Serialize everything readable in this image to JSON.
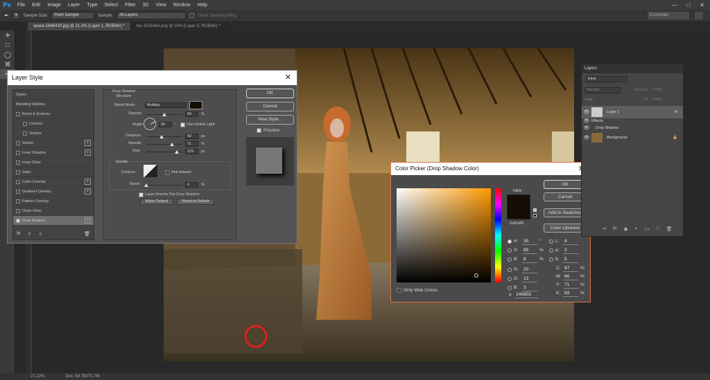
{
  "menubar": {
    "logo": "Ps",
    "items": [
      "File",
      "Edit",
      "Image",
      "Layer",
      "Type",
      "Select",
      "Filter",
      "3D",
      "View",
      "Window",
      "Help"
    ]
  },
  "options": {
    "sample_size_label": "Sample Size:",
    "sample_size_value": "Point Sample",
    "sample_label": "Sample:",
    "sample_value": "All Layers",
    "sampling_ring": "Show Sampling Ring",
    "workspace": "Essentials"
  },
  "tabs": [
    "space-1646420.jpg @ 21.2% (Layer 1, RGB/8#) *",
    "tax-1625464.png @ 25% (Layer 0, RGB/8#) *"
  ],
  "status": {
    "zoom": "21.22%",
    "doc": "Doc: 59.7M/73.7M"
  },
  "layer_style": {
    "title": "Layer Style",
    "styles_header": "Styles",
    "items": [
      {
        "label": "Blending Options",
        "checkbox": false,
        "plus": false,
        "indent": false,
        "checked": false
      },
      {
        "label": "Bevel & Emboss",
        "checkbox": true,
        "plus": false,
        "indent": false,
        "checked": false
      },
      {
        "label": "Contour",
        "checkbox": true,
        "plus": false,
        "indent": true,
        "checked": false
      },
      {
        "label": "Texture",
        "checkbox": true,
        "plus": false,
        "indent": true,
        "checked": false
      },
      {
        "label": "Stroke",
        "checkbox": true,
        "plus": true,
        "indent": false,
        "checked": false
      },
      {
        "label": "Inner Shadow",
        "checkbox": true,
        "plus": true,
        "indent": false,
        "checked": false
      },
      {
        "label": "Inner Glow",
        "checkbox": true,
        "plus": false,
        "indent": false,
        "checked": false
      },
      {
        "label": "Satin",
        "checkbox": true,
        "plus": false,
        "indent": false,
        "checked": false
      },
      {
        "label": "Color Overlay",
        "checkbox": true,
        "plus": true,
        "indent": false,
        "checked": false
      },
      {
        "label": "Gradient Overlay",
        "checkbox": true,
        "plus": true,
        "indent": false,
        "checked": false
      },
      {
        "label": "Pattern Overlay",
        "checkbox": true,
        "plus": false,
        "indent": false,
        "checked": false
      },
      {
        "label": "Outer Glow",
        "checkbox": true,
        "plus": false,
        "indent": false,
        "checked": false
      },
      {
        "label": "Drop Shadow",
        "checkbox": true,
        "plus": true,
        "indent": false,
        "checked": true
      }
    ],
    "fx": "fx",
    "drop_shadow": "Drop Shadow",
    "structure": "Structure",
    "blend_mode_label": "Blend Mode:",
    "blend_mode": "Multiply",
    "opacity_label": "Opacity:",
    "opacity": "50",
    "opacity_unit": "%",
    "angle_label": "Angle:",
    "angle": "30",
    "angle_unit": "°",
    "global_light": "Use Global Light",
    "distance_label": "Distance:",
    "distance": "42",
    "distance_unit": "px",
    "spread_label": "Spread:",
    "spread": "71",
    "spread_unit": "%",
    "size_label": "Size:",
    "size": "229",
    "size_unit": "px",
    "quality": "Quality",
    "contour_label": "Contour:",
    "anti_aliased": "Anti-aliased",
    "noise_label": "Noise:",
    "noise": "0",
    "noise_unit": "%",
    "knocks_out": "Layer Knocks Out Drop Shadow",
    "make_default": "Make Default",
    "reset_default": "Reset to Default",
    "ok": "OK",
    "cancel": "Cancel",
    "new_style": "New Style...",
    "preview": "Preview",
    "shadow_color": "#140d03",
    "levels": {
      "opacity": 0.5,
      "distance": 0.42,
      "spread": 0.71,
      "size": 0.85,
      "noise": 0.0
    }
  },
  "color_picker": {
    "title": "Color Picker (Drop Shadow Color)",
    "new_label": "new",
    "current_label": "current",
    "ok": "OK",
    "cancel": "Cancel",
    "add_swatches": "Add to Swatches",
    "color_libraries": "Color Libraries",
    "only_web": "Only Web Colors",
    "fields": [
      {
        "label": "H:",
        "value": "35",
        "unit": "°",
        "on": true
      },
      {
        "label": "S:",
        "value": "85",
        "unit": "%",
        "on": false
      },
      {
        "label": "B:",
        "value": "8",
        "unit": "%",
        "on": false
      },
      {
        "label": "R:",
        "value": "20",
        "unit": "",
        "on": false
      },
      {
        "label": "G:",
        "value": "13",
        "unit": "",
        "on": false
      },
      {
        "label": "B:",
        "value": "3",
        "unit": "",
        "on": false
      }
    ],
    "lab": [
      {
        "label": "L:",
        "value": "4"
      },
      {
        "label": "a:",
        "value": "2"
      },
      {
        "label": "b:",
        "value": "5"
      }
    ],
    "cmyk": [
      {
        "label": "C:",
        "value": "67",
        "unit": "%"
      },
      {
        "label": "M:",
        "value": "66",
        "unit": "%"
      },
      {
        "label": "Y:",
        "value": "71",
        "unit": "%"
      },
      {
        "label": "K:",
        "value": "83",
        "unit": "%"
      }
    ],
    "hash": "#",
    "hex": "140d03",
    "color": "#140d03"
  },
  "layers": {
    "tab": "Layers",
    "kind": "Kind",
    "blend": "Normal",
    "opacity_label": "Opacity:",
    "opacity": "100%",
    "lock_label": "Lock:",
    "fill_label": "Fill:",
    "fill": "100%",
    "layer1": "Layer 1",
    "fx": "fx",
    "effects": "Effects",
    "drop_shadow": "Drop Shadow",
    "background": "Background"
  }
}
